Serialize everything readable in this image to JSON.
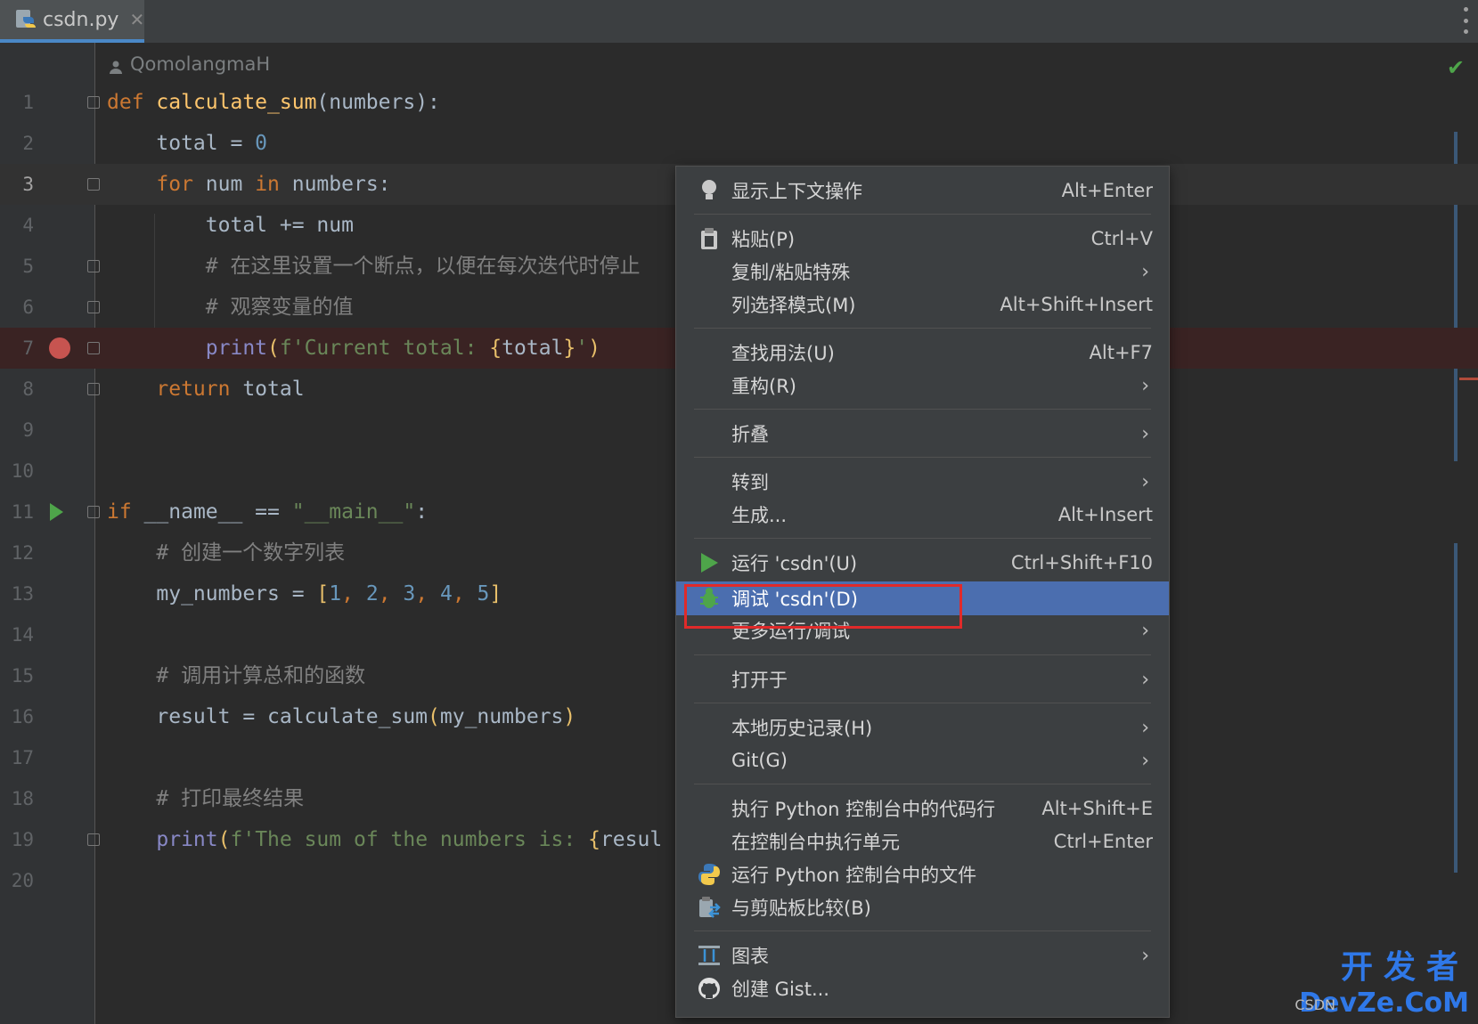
{
  "tab": {
    "filename": "csdn.py",
    "close": "✕"
  },
  "editor": {
    "author": "QomolangmaH"
  },
  "lines": [
    {
      "n": "1"
    },
    {
      "n": "2"
    },
    {
      "n": "3"
    },
    {
      "n": "4"
    },
    {
      "n": "5"
    },
    {
      "n": "6"
    },
    {
      "n": "7"
    },
    {
      "n": "8"
    },
    {
      "n": "9"
    },
    {
      "n": "10"
    },
    {
      "n": "11"
    },
    {
      "n": "12"
    },
    {
      "n": "13"
    },
    {
      "n": "14"
    },
    {
      "n": "15"
    },
    {
      "n": "16"
    },
    {
      "n": "17"
    },
    {
      "n": "18"
    },
    {
      "n": "19"
    },
    {
      "n": "20"
    }
  ],
  "code": {
    "l1": {
      "kw": "def",
      "fn": "calculate_sum",
      "rest": "(numbers):"
    },
    "l2": {
      "a": "total = ",
      "num": "0"
    },
    "l3": {
      "kw1": "for",
      "mid": " num ",
      "kw2": "in",
      "rest": " numbers:"
    },
    "l4": {
      "a": "total += num"
    },
    "l5": {
      "cm": "# 在这里设置一个断点，以便在每次迭代时停止"
    },
    "l6": {
      "cm": "# 观察变量的值"
    },
    "l7": {
      "bi": "print",
      "p1": "(",
      "str1": "f'Current total: ",
      "b1": "{",
      "v": "total",
      "b2": "}",
      "str2": "'",
      ")": ")"
    },
    "l8": {
      "kw": "return",
      "rest": " total"
    },
    "l11": {
      "kw": "if",
      "mid": " __name__ == ",
      "str": "\"__main__\"",
      "rest": ":"
    },
    "l12": {
      "cm": "# 创建一个数字列表"
    },
    "l13": {
      "a": "my_numbers = ",
      "br1": "[",
      "n1": "1",
      "c1": ", ",
      "n2": "2",
      "c2": ", ",
      "n3": "3",
      "c3": ", ",
      "n4": "4",
      "c4": ", ",
      "n5": "5",
      "br2": "]"
    },
    "l15": {
      "cm": "# 调用计算总和的函数"
    },
    "l16": {
      "a": "result = calculate_sum",
      "br1": "(",
      "v": "my_numbers",
      "br2": ")"
    },
    "l18": {
      "cm": "# 打印最终结果"
    },
    "l19": {
      "bi": "print",
      "p1": "(",
      "str": "f'The sum of the numbers is: ",
      "b1": "{",
      "v": "resul"
    }
  },
  "menu": {
    "items": [
      {
        "label": "显示上下文操作",
        "shortcut": "Alt+Enter",
        "icon": "lightbulb-icon"
      },
      {
        "label": "粘贴(P)",
        "shortcut": "Ctrl+V",
        "icon": "clipboard-icon"
      },
      {
        "label": "复制/粘贴特殊",
        "submenu": "›"
      },
      {
        "label": "列选择模式(M)",
        "shortcut": "Alt+Shift+Insert"
      },
      {
        "label": "查找用法(U)",
        "shortcut": "Alt+F7"
      },
      {
        "label": "重构(R)",
        "submenu": "›"
      },
      {
        "label": "折叠",
        "submenu": "›"
      },
      {
        "label": "转到",
        "submenu": "›"
      },
      {
        "label": "生成...",
        "shortcut": "Alt+Insert"
      },
      {
        "label": "运行 'csdn'(U)",
        "shortcut": "Ctrl+Shift+F10",
        "icon": "run-icon"
      },
      {
        "label": "调试 'csdn'(D)",
        "icon": "debug-bug-icon",
        "selected": true
      },
      {
        "label": "更多运行/调试",
        "submenu": "›"
      },
      {
        "label": "打开于",
        "submenu": "›"
      },
      {
        "label": "本地历史记录(H)",
        "submenu": "›"
      },
      {
        "label": "Git(G)",
        "submenu": "›"
      },
      {
        "label": "执行 Python 控制台中的代码行",
        "shortcut": "Alt+Shift+E"
      },
      {
        "label": "在控制台中执行单元",
        "shortcut": "Ctrl+Enter"
      },
      {
        "label": "运行 Python 控制台中的文件",
        "icon": "python-icon"
      },
      {
        "label": "与剪贴板比较(B)",
        "icon": "compare-clipboard-icon"
      },
      {
        "label": "图表",
        "submenu": "›",
        "icon": "diagram-icon"
      },
      {
        "label": "创建 Gist...",
        "icon": "github-icon"
      }
    ]
  },
  "watermark": {
    "small": "CSDN",
    "line1": "开发者",
    "line2": "DevZe.CoM"
  },
  "colors": {
    "selection": "#4b6eaf",
    "breakpoint": "#c75450",
    "run": "#4ea54a",
    "highlight_box": "#e02a2a"
  }
}
